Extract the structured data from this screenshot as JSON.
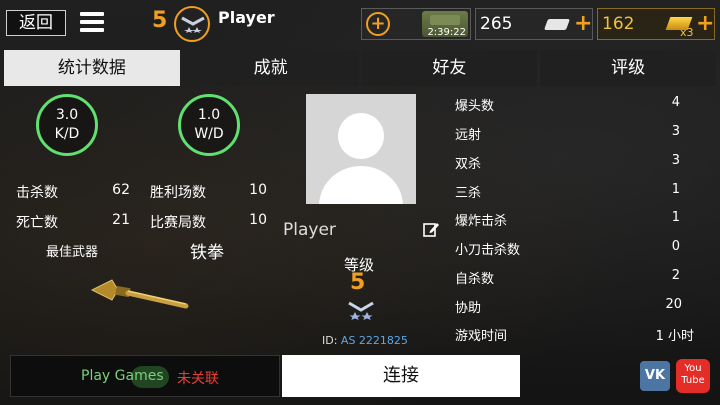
{
  "header": {
    "back_label": "返回",
    "level": "5",
    "player_name": "Player"
  },
  "resources": {
    "vehicle_timer": "2:39:22",
    "cash": "265",
    "gold": "162",
    "gold_multiplier": "x3"
  },
  "tabs": [
    "统计数据",
    "成就",
    "好友",
    "评级"
  ],
  "summary": {
    "kd_value": "3.0",
    "kd_label": "K/D",
    "wd_value": "1.0",
    "wd_label": "W/D",
    "kills_label": "击杀数",
    "kills": "62",
    "deaths_label": "死亡数",
    "deaths": "21",
    "wins_label": "胜利场数",
    "wins": "10",
    "matches_label": "比赛局数",
    "matches": "10",
    "best_weapon_label": "最佳武器",
    "best_weapon": "铁拳"
  },
  "profile": {
    "name": "Player",
    "level_label": "等级",
    "level": "5",
    "id_prefix": "ID:",
    "id_value": "AS 2221825"
  },
  "details": [
    {
      "label": "爆头数",
      "value": "4"
    },
    {
      "label": "远射",
      "value": "3"
    },
    {
      "label": "双杀",
      "value": "3"
    },
    {
      "label": "三杀",
      "value": "1"
    },
    {
      "label": "爆炸击杀",
      "value": "1"
    },
    {
      "label": "小刀击杀数",
      "value": "0"
    },
    {
      "label": "自杀数",
      "value": "2"
    },
    {
      "label": "协助",
      "value": "20"
    },
    {
      "label": "游戏时间",
      "value": "1 小时"
    }
  ],
  "footer": {
    "play_games_label": "Play Games",
    "play_games_status": "未关联",
    "connect_label": "连接",
    "vk_label": "VK",
    "youtube_label": "You Tube"
  },
  "colors": {
    "accent_orange": "#f0a020",
    "ring_green": "#5fe070",
    "id_blue": "#5aa8e8",
    "unlinked_red": "#e84030"
  }
}
